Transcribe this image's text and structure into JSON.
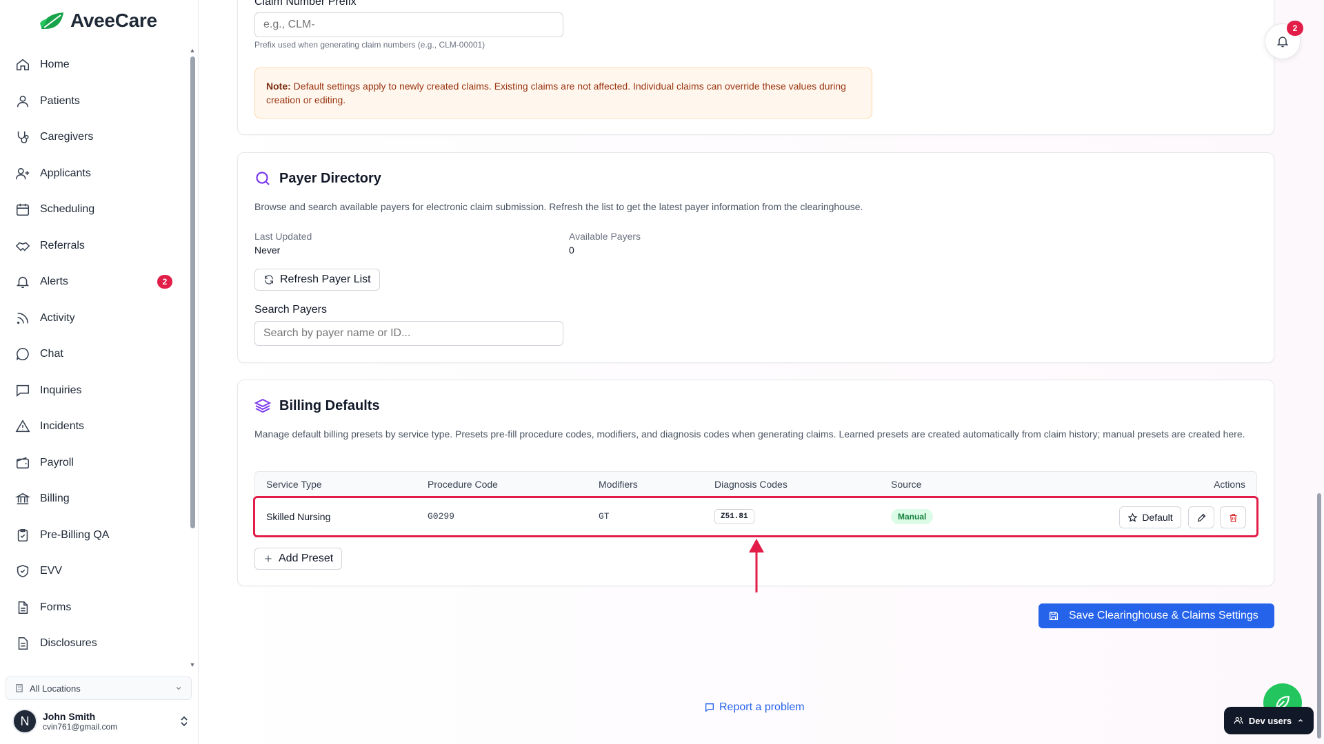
{
  "app": {
    "name": "AveeCare"
  },
  "sidebar": {
    "items": [
      {
        "label": "Home",
        "icon": "home-icon"
      },
      {
        "label": "Patients",
        "icon": "user-icon"
      },
      {
        "label": "Caregivers",
        "icon": "stethoscope-icon"
      },
      {
        "label": "Applicants",
        "icon": "user-plus-icon"
      },
      {
        "label": "Scheduling",
        "icon": "calendar-icon"
      },
      {
        "label": "Referrals",
        "icon": "handshake-icon"
      },
      {
        "label": "Alerts",
        "icon": "bell-icon",
        "badge": "2"
      },
      {
        "label": "Activity",
        "icon": "rss-icon"
      },
      {
        "label": "Chat",
        "icon": "chat-bubble-icon"
      },
      {
        "label": "Inquiries",
        "icon": "message-square-icon"
      },
      {
        "label": "Incidents",
        "icon": "warning-triangle-icon"
      },
      {
        "label": "Payroll",
        "icon": "wallet-icon"
      },
      {
        "label": "Billing",
        "icon": "bank-icon"
      },
      {
        "label": "Pre-Billing QA",
        "icon": "clipboard-check-icon"
      },
      {
        "label": "EVV",
        "icon": "shield-check-icon"
      },
      {
        "label": "Forms",
        "icon": "file-text-icon"
      },
      {
        "label": "Disclosures",
        "icon": "document-icon"
      }
    ],
    "location": "All Locations",
    "user": {
      "initial": "N",
      "name": "John Smith",
      "email": "cvin761@gmail.com"
    }
  },
  "claims": {
    "prefix_label": "Claim Number Prefix",
    "prefix_placeholder": "e.g., CLM-",
    "prefix_help": "Prefix used when generating claim numbers (e.g., CLM-00001)",
    "note_label": "Note:",
    "note_text": " Default settings apply to newly created claims. Existing claims are not affected. Individual claims can override these values during creation or editing."
  },
  "payer": {
    "title": "Payer Directory",
    "description": "Browse and search available payers for electronic claim submission. Refresh the list to get the latest payer information from the clearinghouse.",
    "last_updated_label": "Last Updated",
    "last_updated_value": "Never",
    "available_label": "Available Payers",
    "available_value": "0",
    "refresh_label": "Refresh Payer List",
    "search_label": "Search Payers",
    "search_placeholder": "Search by payer name or ID..."
  },
  "billing": {
    "title": "Billing Defaults",
    "description": "Manage default billing presets by service type. Presets pre-fill procedure codes, modifiers, and diagnosis codes when generating claims. Learned presets are created automatically from claim history; manual presets are created here.",
    "columns": [
      "Service Type",
      "Procedure Code",
      "Modifiers",
      "Diagnosis Codes",
      "Source",
      "Actions"
    ],
    "rows": [
      {
        "service_type": "Skilled Nursing",
        "procedure_code": "G0299",
        "modifiers": "GT",
        "diagnosis_code": "Z51.81",
        "source": "Manual",
        "default_label": "Default"
      }
    ],
    "add_label": "Add Preset"
  },
  "actions": {
    "save_label": "Save Clearinghouse & Claims Settings",
    "report_label": "Report a problem",
    "dev_users_label": "Dev users",
    "notifications_badge": "2"
  },
  "colors": {
    "accent": "#2563eb",
    "brand_purple": "#7c3aed",
    "highlight": "#e11d48",
    "brand_green": "#22c55e"
  }
}
